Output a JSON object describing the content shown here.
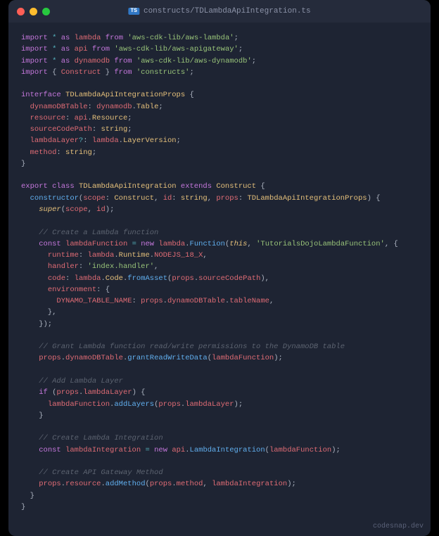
{
  "window": {
    "filename": "constructs/TDLambdaApiIntegration.ts",
    "file_badge": "TS"
  },
  "footer": {
    "watermark": "codesnap.dev"
  },
  "code": {
    "lines": [
      [
        [
          "kw",
          "import"
        ],
        [
          "pn",
          " "
        ],
        [
          "op",
          "*"
        ],
        [
          "pn",
          " "
        ],
        [
          "kw",
          "as"
        ],
        [
          "pn",
          " "
        ],
        [
          "id",
          "lambda"
        ],
        [
          "pn",
          " "
        ],
        [
          "kw",
          "from"
        ],
        [
          "pn",
          " "
        ],
        [
          "str",
          "'aws-cdk-lib/aws-lambda'"
        ],
        [
          "pn",
          ";"
        ]
      ],
      [
        [
          "kw",
          "import"
        ],
        [
          "pn",
          " "
        ],
        [
          "op",
          "*"
        ],
        [
          "pn",
          " "
        ],
        [
          "kw",
          "as"
        ],
        [
          "pn",
          " "
        ],
        [
          "id",
          "api"
        ],
        [
          "pn",
          " "
        ],
        [
          "kw",
          "from"
        ],
        [
          "pn",
          " "
        ],
        [
          "str",
          "'aws-cdk-lib/aws-apigateway'"
        ],
        [
          "pn",
          ";"
        ]
      ],
      [
        [
          "kw",
          "import"
        ],
        [
          "pn",
          " "
        ],
        [
          "op",
          "*"
        ],
        [
          "pn",
          " "
        ],
        [
          "kw",
          "as"
        ],
        [
          "pn",
          " "
        ],
        [
          "id",
          "dynamodb"
        ],
        [
          "pn",
          " "
        ],
        [
          "kw",
          "from"
        ],
        [
          "pn",
          " "
        ],
        [
          "str",
          "'aws-cdk-lib/aws-dynamodb'"
        ],
        [
          "pn",
          ";"
        ]
      ],
      [
        [
          "kw",
          "import"
        ],
        [
          "pn",
          " { "
        ],
        [
          "id",
          "Construct"
        ],
        [
          "pn",
          " } "
        ],
        [
          "kw",
          "from"
        ],
        [
          "pn",
          " "
        ],
        [
          "str",
          "'constructs'"
        ],
        [
          "pn",
          ";"
        ]
      ],
      [],
      [
        [
          "kw",
          "interface"
        ],
        [
          "pn",
          " "
        ],
        [
          "cls",
          "TDLambdaApiIntegrationProps"
        ],
        [
          "pn",
          " {"
        ]
      ],
      [
        [
          "pn",
          "  "
        ],
        [
          "prop",
          "dynamoDBTable"
        ],
        [
          "pn",
          ": "
        ],
        [
          "id",
          "dynamodb"
        ],
        [
          "pn",
          "."
        ],
        [
          "cls",
          "Table"
        ],
        [
          "pn",
          ";"
        ]
      ],
      [
        [
          "pn",
          "  "
        ],
        [
          "prop",
          "resource"
        ],
        [
          "pn",
          ": "
        ],
        [
          "id",
          "api"
        ],
        [
          "pn",
          "."
        ],
        [
          "cls",
          "Resource"
        ],
        [
          "pn",
          ";"
        ]
      ],
      [
        [
          "pn",
          "  "
        ],
        [
          "prop",
          "sourceCodePath"
        ],
        [
          "pn",
          ": "
        ],
        [
          "cls",
          "string"
        ],
        [
          "pn",
          ";"
        ]
      ],
      [
        [
          "pn",
          "  "
        ],
        [
          "prop",
          "lambdaLayer"
        ],
        [
          "op",
          "?"
        ],
        [
          "pn",
          ": "
        ],
        [
          "id",
          "lambda"
        ],
        [
          "pn",
          "."
        ],
        [
          "cls",
          "LayerVersion"
        ],
        [
          "pn",
          ";"
        ]
      ],
      [
        [
          "pn",
          "  "
        ],
        [
          "prop",
          "method"
        ],
        [
          "pn",
          ": "
        ],
        [
          "cls",
          "string"
        ],
        [
          "pn",
          ";"
        ]
      ],
      [
        [
          "pn",
          "}"
        ]
      ],
      [],
      [
        [
          "kw",
          "export"
        ],
        [
          "pn",
          " "
        ],
        [
          "kw",
          "class"
        ],
        [
          "pn",
          " "
        ],
        [
          "cls",
          "TDLambdaApiIntegration"
        ],
        [
          "pn",
          " "
        ],
        [
          "kw",
          "extends"
        ],
        [
          "pn",
          " "
        ],
        [
          "cls",
          "Construct"
        ],
        [
          "pn",
          " {"
        ]
      ],
      [
        [
          "pn",
          "  "
        ],
        [
          "fn",
          "constructor"
        ],
        [
          "pn",
          "("
        ],
        [
          "id",
          "scope"
        ],
        [
          "pn",
          ": "
        ],
        [
          "cls",
          "Construct"
        ],
        [
          "pn",
          ", "
        ],
        [
          "id",
          "id"
        ],
        [
          "pn",
          ": "
        ],
        [
          "cls",
          "string"
        ],
        [
          "pn",
          ", "
        ],
        [
          "id",
          "props"
        ],
        [
          "pn",
          ": "
        ],
        [
          "cls",
          "TDLambdaApiIntegrationProps"
        ],
        [
          "pn",
          ") {"
        ]
      ],
      [
        [
          "pn",
          "    "
        ],
        [
          "this",
          "super"
        ],
        [
          "pn",
          "("
        ],
        [
          "id",
          "scope"
        ],
        [
          "pn",
          ", "
        ],
        [
          "id",
          "id"
        ],
        [
          "pn",
          ");"
        ]
      ],
      [],
      [
        [
          "pn",
          "    "
        ],
        [
          "cmt",
          "// Create a Lambda function"
        ]
      ],
      [
        [
          "pn",
          "    "
        ],
        [
          "kw",
          "const"
        ],
        [
          "pn",
          " "
        ],
        [
          "id",
          "lambdaFunction"
        ],
        [
          "pn",
          " "
        ],
        [
          "op",
          "="
        ],
        [
          "pn",
          " "
        ],
        [
          "kw",
          "new"
        ],
        [
          "pn",
          " "
        ],
        [
          "id",
          "lambda"
        ],
        [
          "pn",
          "."
        ],
        [
          "fn",
          "Function"
        ],
        [
          "pn",
          "("
        ],
        [
          "this",
          "this"
        ],
        [
          "pn",
          ", "
        ],
        [
          "str",
          "'TutorialsDojoLambdaFunction'"
        ],
        [
          "pn",
          ", {"
        ]
      ],
      [
        [
          "pn",
          "      "
        ],
        [
          "prop",
          "runtime"
        ],
        [
          "pn",
          ": "
        ],
        [
          "id",
          "lambda"
        ],
        [
          "pn",
          "."
        ],
        [
          "cls",
          "Runtime"
        ],
        [
          "pn",
          "."
        ],
        [
          "id",
          "NODEJS_18_X"
        ],
        [
          "pn",
          ","
        ]
      ],
      [
        [
          "pn",
          "      "
        ],
        [
          "prop",
          "handler"
        ],
        [
          "pn",
          ": "
        ],
        [
          "str",
          "'index.handler'"
        ],
        [
          "pn",
          ","
        ]
      ],
      [
        [
          "pn",
          "      "
        ],
        [
          "prop",
          "code"
        ],
        [
          "pn",
          ": "
        ],
        [
          "id",
          "lambda"
        ],
        [
          "pn",
          "."
        ],
        [
          "cls",
          "Code"
        ],
        [
          "pn",
          "."
        ],
        [
          "fn",
          "fromAsset"
        ],
        [
          "pn",
          "("
        ],
        [
          "id",
          "props"
        ],
        [
          "pn",
          "."
        ],
        [
          "id",
          "sourceCodePath"
        ],
        [
          "pn",
          "),"
        ]
      ],
      [
        [
          "pn",
          "      "
        ],
        [
          "prop",
          "environment"
        ],
        [
          "pn",
          ": {"
        ]
      ],
      [
        [
          "pn",
          "        "
        ],
        [
          "id",
          "DYNAMO_TABLE_NAME"
        ],
        [
          "pn",
          ": "
        ],
        [
          "id",
          "props"
        ],
        [
          "pn",
          "."
        ],
        [
          "id",
          "dynamoDBTable"
        ],
        [
          "pn",
          "."
        ],
        [
          "id",
          "tableName"
        ],
        [
          "pn",
          ","
        ]
      ],
      [
        [
          "pn",
          "      },"
        ]
      ],
      [
        [
          "pn",
          "    });"
        ]
      ],
      [],
      [
        [
          "pn",
          "    "
        ],
        [
          "cmt",
          "// Grant Lambda function read/write permissions to the DynamoDB table"
        ]
      ],
      [
        [
          "pn",
          "    "
        ],
        [
          "id",
          "props"
        ],
        [
          "pn",
          "."
        ],
        [
          "id",
          "dynamoDBTable"
        ],
        [
          "pn",
          "."
        ],
        [
          "fn",
          "grantReadWriteData"
        ],
        [
          "pn",
          "("
        ],
        [
          "id",
          "lambdaFunction"
        ],
        [
          "pn",
          ");"
        ]
      ],
      [],
      [
        [
          "pn",
          "    "
        ],
        [
          "cmt",
          "// Add Lambda Layer"
        ]
      ],
      [
        [
          "pn",
          "    "
        ],
        [
          "kw",
          "if"
        ],
        [
          "pn",
          " ("
        ],
        [
          "id",
          "props"
        ],
        [
          "pn",
          "."
        ],
        [
          "id",
          "lambdaLayer"
        ],
        [
          "pn",
          ") {"
        ]
      ],
      [
        [
          "pn",
          "      "
        ],
        [
          "id",
          "lambdaFunction"
        ],
        [
          "pn",
          "."
        ],
        [
          "fn",
          "addLayers"
        ],
        [
          "pn",
          "("
        ],
        [
          "id",
          "props"
        ],
        [
          "pn",
          "."
        ],
        [
          "id",
          "lambdaLayer"
        ],
        [
          "pn",
          ");"
        ]
      ],
      [
        [
          "pn",
          "    }"
        ]
      ],
      [],
      [
        [
          "pn",
          "    "
        ],
        [
          "cmt",
          "// Create Lambda Integration"
        ]
      ],
      [
        [
          "pn",
          "    "
        ],
        [
          "kw",
          "const"
        ],
        [
          "pn",
          " "
        ],
        [
          "id",
          "lambdaIntegration"
        ],
        [
          "pn",
          " "
        ],
        [
          "op",
          "="
        ],
        [
          "pn",
          " "
        ],
        [
          "kw",
          "new"
        ],
        [
          "pn",
          " "
        ],
        [
          "id",
          "api"
        ],
        [
          "pn",
          "."
        ],
        [
          "fn",
          "LambdaIntegration"
        ],
        [
          "pn",
          "("
        ],
        [
          "id",
          "lambdaFunction"
        ],
        [
          "pn",
          ");"
        ]
      ],
      [],
      [
        [
          "pn",
          "    "
        ],
        [
          "cmt",
          "// Create API Gateway Method"
        ]
      ],
      [
        [
          "pn",
          "    "
        ],
        [
          "id",
          "props"
        ],
        [
          "pn",
          "."
        ],
        [
          "id",
          "resource"
        ],
        [
          "pn",
          "."
        ],
        [
          "fn",
          "addMethod"
        ],
        [
          "pn",
          "("
        ],
        [
          "id",
          "props"
        ],
        [
          "pn",
          "."
        ],
        [
          "id",
          "method"
        ],
        [
          "pn",
          ", "
        ],
        [
          "id",
          "lambdaIntegration"
        ],
        [
          "pn",
          ");"
        ]
      ],
      [
        [
          "pn",
          "  }"
        ]
      ],
      [
        [
          "pn",
          "}"
        ]
      ]
    ]
  }
}
